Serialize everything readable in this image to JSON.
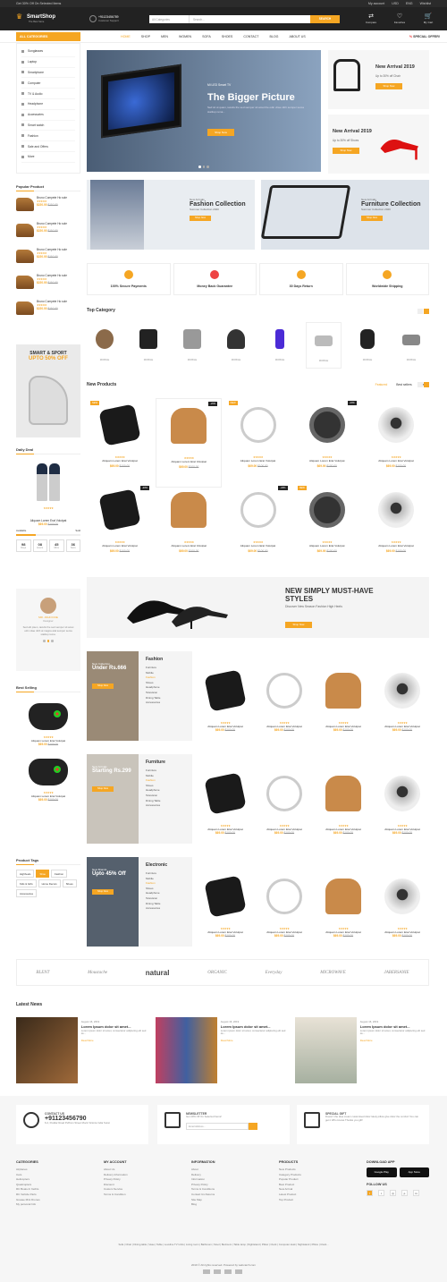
{
  "topbar": {
    "promo": "Get 30% Off On Selected Items",
    "links": [
      "My account",
      "USD",
      "ENG",
      "Wishlist"
    ]
  },
  "header": {
    "brand": "SmartShop",
    "tagline": "The Best Store",
    "phone": "+91123456789",
    "phone_sub": "Customer Support",
    "search_cat": "All Categories",
    "search_ph": "Search...",
    "search_btn": "SEARCH",
    "icons": [
      {
        "name": "Compare",
        "icon": "compare-icon"
      },
      {
        "name": "Favorites",
        "icon": "heart-icon"
      },
      {
        "name": "My Cart",
        "icon": "cart-icon"
      }
    ]
  },
  "nav": {
    "all": "ALL CATEGORIES",
    "items": [
      "HOME",
      "SHOP",
      "MEN",
      "WOMEN",
      "SOFA",
      "SHOES",
      "CONTACT",
      "BLOG",
      "ABOUT US"
    ],
    "special": "SPECIAL OFFER!"
  },
  "categories": [
    "Sunglasses",
    "Laptop",
    "Smartphone",
    "Computer",
    "TV & Audio",
    "Headphone",
    "Accessories",
    "Smart watch",
    "Fashion",
    "Sale and Offers",
    "More"
  ],
  "hero": {
    "sub": "Mi LED Smart TV",
    "title": "The Bigger Picture",
    "desc": "Sed sit ut quam, iaculis the sed semper sit amet the odin vitae nibh semper sema statitup rema...",
    "btn": "Shop Now"
  },
  "side_banners": [
    {
      "title": "New Arrival 2019",
      "sub": "Up to 30% off Chair",
      "btn": "Shop Now"
    },
    {
      "title": "New Arrival 2019",
      "sub": "Up to 30% off Shoes",
      "btn": "Shop Now"
    }
  ],
  "popular": {
    "title": "Popular Product",
    "items": [
      {
        "name": "Bruno Compete Ho sole",
        "price": "$220.00",
        "old": "$110.00"
      },
      {
        "name": "Bruno Compete Ho sole",
        "price": "$220.00",
        "old": "$110.00"
      },
      {
        "name": "Bruno Compete Ho sole",
        "price": "$220.00",
        "old": "$110.00"
      },
      {
        "name": "Bruno Compete Ho sole",
        "price": "$220.00",
        "old": "$110.00"
      },
      {
        "name": "Bruno Compete Ho sole",
        "price": "$220.00",
        "old": "$110.00"
      }
    ]
  },
  "collections": [
    {
      "new": "New Arrivals",
      "title": "Fashion Collection",
      "sub": "Summer Collection 2020",
      "btn": "Shop Now"
    },
    {
      "new": "New Arrivals",
      "title": "Furniture Collection",
      "sub": "Summer Collection 2020",
      "btn": "Shop Now"
    }
  ],
  "services": [
    "100% Secure Payments",
    "Money Back Guarantee",
    "30 Days Return",
    "Worldwide Shipping"
  ],
  "top_category": {
    "title": "Top Category",
    "items": [
      "MOBILE",
      "MOBILE",
      "MOBILE",
      "MOBILE",
      "MOBILE",
      "MOBILE",
      "MOBILE",
      "MOBILE"
    ]
  },
  "smart": {
    "title": "SMART & SPORT",
    "sub": "UPTO 50% OFF"
  },
  "deal": {
    "title": "Daily Deal",
    "name": "Aliquam Lorem Erat Volutpat",
    "price": "$69.00",
    "old": "$100.00",
    "available": "Available",
    "sold": "Sold",
    "timer": [
      {
        "v": "98",
        "l": "Days"
      },
      {
        "v": "08",
        "l": "Hours"
      },
      {
        "v": "45",
        "l": "Mins"
      },
      {
        "v": "36",
        "l": "Secs"
      }
    ]
  },
  "new_products": {
    "title": "New Products",
    "tabs": [
      "Featured",
      "Best sellers",
      "Latest"
    ],
    "name": "Aliquam Lorem Erat Volutpat",
    "price": "$69.00",
    "old": "$100.00",
    "badge_new": "NEW",
    "badge_off": "-20%"
  },
  "testimonial": {
    "name": "MR. JOHN DOE",
    "role": "Designer",
    "quote": "Sed elit pisen, iaculis the sed semper sit amet odin vitae nibh at magna atal semper sema statitup rema."
  },
  "banner": {
    "title": "NEW SIMPLY MUST-HAVE STYLES",
    "sub": "Discover New Season Fashion High Heels",
    "btn": "Shop Now"
  },
  "best_selling": {
    "title": "Best Selling",
    "name": "Aliquam Lorem Erat Volutpat",
    "price": "$69.00",
    "old": "$100.00"
  },
  "cat_rows": [
    {
      "name": "Fashion",
      "promo_new": "New Collection",
      "promo": "Under Rs.666",
      "btn": "Shop Now",
      "links": [
        "Furniture",
        "Mobile",
        "Fashion",
        "Shoes",
        "Headphone",
        "Television",
        "Dining Table",
        "Accessories"
      ]
    },
    {
      "name": "Furniture",
      "promo_new": "New Arrivals",
      "promo": "Starting Rs.299",
      "btn": "Shop Now",
      "links": [
        "Furniture",
        "Mobile",
        "Fashion",
        "Shoes",
        "Headphone",
        "Television",
        "Dining Table",
        "Accessories"
      ]
    },
    {
      "name": "Electronic",
      "promo_new": "New Brands",
      "promo": "Upto 45% Off",
      "btn": "Shop Now",
      "links": [
        "Furniture",
        "Mobile",
        "Fashion",
        "Shoes",
        "Headphone",
        "Television",
        "Dining Table",
        "Accessories"
      ]
    }
  ],
  "tags": {
    "title": "Product Tags",
    "items": [
      "Highheels",
      "Shoe",
      "Fashion",
      "Kids & Girls",
      "Home Decors",
      "Shoes",
      "Accessories"
    ]
  },
  "brands": [
    "BLENT",
    "Moustache",
    "natural",
    "ORGANIC",
    "Everyday",
    "MICROWAVE",
    "JABERSANIE"
  ],
  "news": {
    "title": "Latest News",
    "items": [
      {
        "date": "August 16, 2019",
        "title": "Lorem Ipsum dolor sit amet...",
        "body": "Lorem ipsum dolor sit amet, consectetur adipiscing elit sed do...",
        "more": "Read More"
      },
      {
        "date": "August 16, 2019",
        "title": "Lorem Ipsum dolor sit amet...",
        "body": "Lorem ipsum dolor sit amet, consectetur adipiscing elit sed do...",
        "more": "Read More"
      },
      {
        "date": "August 16, 2019",
        "title": "Lorem Ipsum dolor sit amet...",
        "body": "Lorem ipsum dolor sit amet, consectetur adipiscing elit sed do...",
        "more": "Read More"
      }
    ]
  },
  "footer": {
    "contact_h": "CONTACT US",
    "contact_phone": "+91123456790",
    "contact_addr": "6-2, Poddar Road Puffrom Street Mock Victoria India Surat",
    "news_h": "NEWSLETTER",
    "news_sub": "Get 40% Off On Selected Items!",
    "news_ph": "Email Address...",
    "gift_h": "SPECIAL GIFT",
    "gift_sub": "Doesn't the idea cream customised dolor lately pillow give dolor the comfort You can get it Who knows Thanks you gift!",
    "cols": [
      {
        "h": "CATEGORIES",
        "l": [
          "Airplanes",
          "Cars",
          "Helicopters",
          "Quadcopters",
          "RC Boats & Yachts",
          "RC Vehicle Parts",
          "Grease Mini Drones",
          "My personal Info"
        ]
      },
      {
        "h": "MY ACCOUNT",
        "l": [
          "About Us",
          "Delivery Information",
          "Privacy Policy",
          "Discount",
          "Custom Service",
          "Terms & Condition"
        ]
      },
      {
        "h": "INFORMATION",
        "l": [
          "About",
          "Delivery",
          "Information",
          "Privacy Policy",
          "Terms & Conditions",
          "Contact Us Returns",
          "Site Map",
          "Blog"
        ]
      },
      {
        "h": "PRODUCTS",
        "l": [
          "New Products",
          "Category Products",
          "Popular Product",
          "Best Product",
          "New Arrival",
          "Latest Product",
          "Top Product"
        ]
      }
    ],
    "app_h": "DOWNLOAD APP",
    "apps": [
      "Google Play",
      "App Store"
    ],
    "follow": "FOLLOW US",
    "links": "Sofa | Chair | Dining table | Vase | Table | Loveline TV Units | Living room | Bathroom | Stool | Bedroom | Table lamp | Nightstand | Pillow | Clock | Computer desk | Nightstand | Pillow | Clock...",
    "copy": "2019 © All rights reserved. Powered by webcarch.com"
  }
}
